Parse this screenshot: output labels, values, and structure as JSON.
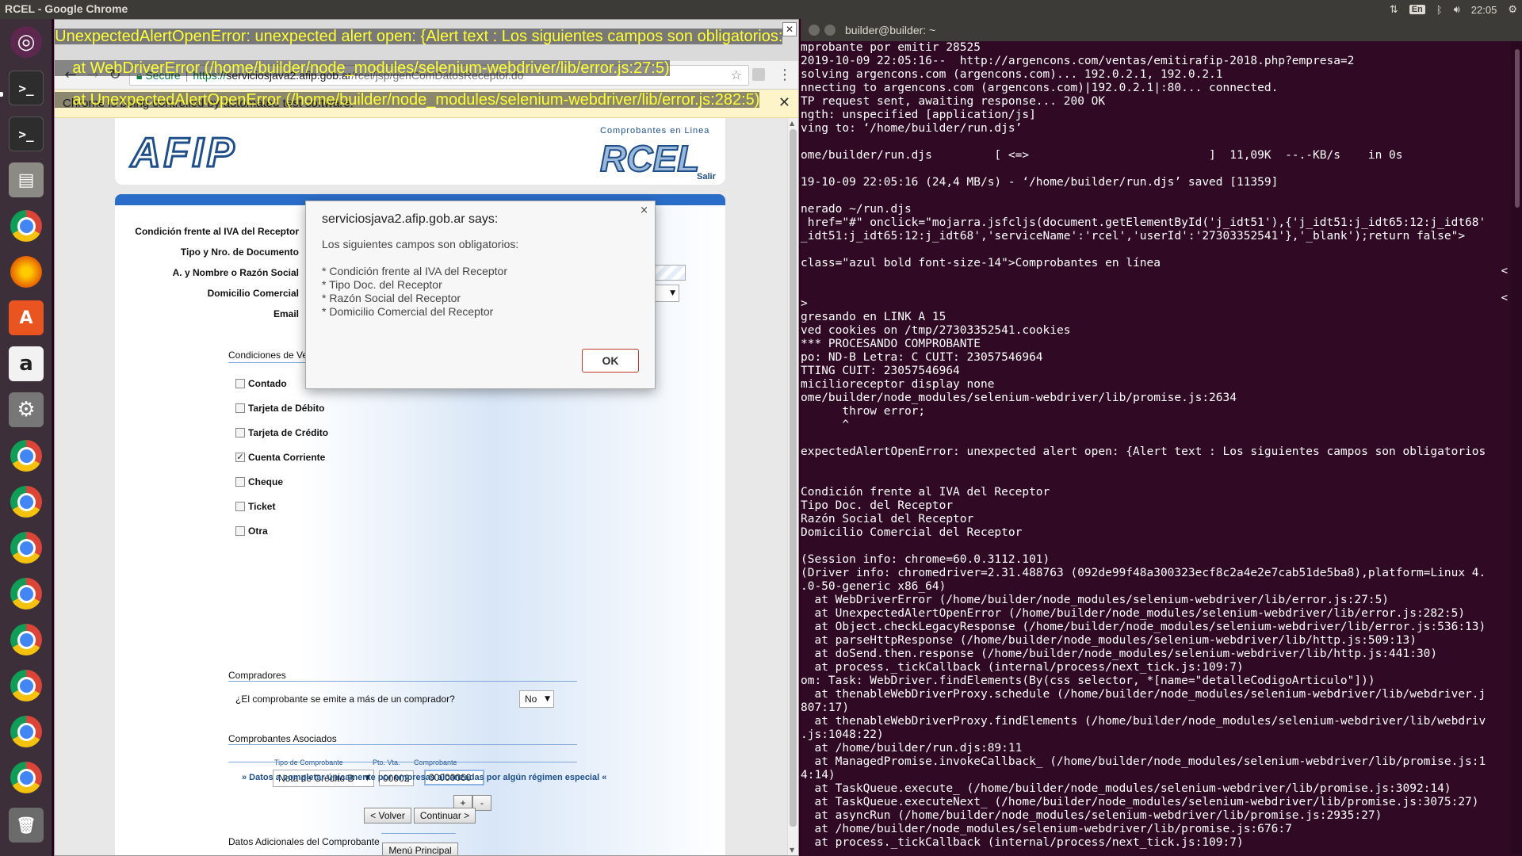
{
  "panel": {
    "app_title": "RCEL - Google Chrome",
    "keyboard_layout": "En",
    "clock": "22:05"
  },
  "error_overlay": {
    "lines": [
      "UnexpectedAlertOpenError: unexpected alert open: {Alert text : Los siguientes campos son obligatorios:",
      "    at WebDriverError (/home/builder/node_modules/selenium-webdriver/lib/error.js:27:5)",
      "    at UnexpectedAlertOpenError (/home/builder/node_modules/selenium-webdriver/lib/error.js:282:5)"
    ]
  },
  "chrome": {
    "close_glyph": "✕",
    "omnibox": {
      "secure_label": "Secure",
      "scheme": "https://",
      "host": "serviciosjava2.afip.gob.ar",
      "path": "/rcel/jsp/genComDatosReceptor.do"
    },
    "infobar": {
      "text": "Chrome is being controlled by automated test software."
    }
  },
  "afip": {
    "logo_text": "AFIP",
    "rcel_subtitle": "Comprobantes en Linea",
    "rcel_logo": "RCEL",
    "salir_label": "Salir",
    "fields": {
      "condicion_iva_label": "Condición frente al IVA del Receptor",
      "tipo_doc_label": "Tipo y Nro. de Documento",
      "razon_social_label": "A. y Nombre o Razón Social",
      "domicilio_label": "Domicilio Comercial",
      "email_label": "Email"
    },
    "condiciones_venta": {
      "title": "Condiciones de Venta",
      "options": [
        {
          "label": "Contado",
          "checked": false
        },
        {
          "label": "Tarjeta de Débito",
          "checked": false
        },
        {
          "label": "Tarjeta de Crédito",
          "checked": false
        },
        {
          "label": "Cuenta Corriente",
          "checked": true
        },
        {
          "label": "Cheque",
          "checked": false
        },
        {
          "label": "Ticket",
          "checked": false
        },
        {
          "label": "Otra",
          "checked": false
        }
      ]
    },
    "compradores": {
      "title": "Compradores",
      "question": "¿El comprobante se emite a más de un comprador?",
      "answer": "No"
    },
    "asociados": {
      "title": "Comprobantes Asociados",
      "col_tipo": "Tipo de Comprobante",
      "col_pto": "Pto. Vta.",
      "col_comprobante": "Comprobante",
      "tipo_value": "Nota de Crédito B",
      "pto_value": "00002",
      "dash": "-",
      "comprobante_value": "00000060",
      "add_label": "+",
      "remove_label": "-"
    },
    "datos_adicionales": {
      "title": "Datos Adicionales del Comprobante",
      "link": "» Datos a completar únicamente por empresas alcanzadas por algún régimen especial «"
    },
    "buttons": {
      "volver": "< Volver",
      "continuar": "Continuar >",
      "menu_principal": "Menú Principal"
    }
  },
  "alert": {
    "title": "serviciosjava2.afip.gob.ar says:",
    "close_glyph": "×",
    "message": "Los siguientes campos son obligatorios:",
    "fields": [
      "* Condición frente al IVA del Receptor",
      "* Tipo Doc. del Receptor",
      "* Razón Social del Receptor",
      "* Domicilio Comercial del Receptor"
    ],
    "ok_label": "OK"
  },
  "terminal": {
    "title": "builder@builder: ~",
    "lines": [
      "mprobante por emitir 28525",
      "2019-10-09 22:05:16--  http://argencons.com/ventas/emitirafip-2018.php?empresa=2",
      "solving argencons.com (argencons.com)... 192.0.2.1, 192.0.2.1",
      "nnecting to argencons.com (argencons.com)|192.0.2.1|:80... connected.",
      "TP request sent, awaiting response... 200 OK",
      "ngth: unspecified [application/js]",
      "ving to: ‘/home/builder/run.djs’",
      "",
      "ome/builder/run.djs         [ <=>                          ]  11,09K  --.-KB/s    in 0s",
      "",
      "19-10-09 22:05:16 (24,4 MB/s) - ‘/home/builder/run.djs’ saved [11359]",
      "",
      "nerado ~/run.djs",
      " href=\"#\" onclick=\"mojarra.jsfcljs(document.getElementById('j_idt51'),{'j_idt51:j_idt65:12:j_idt68'",
      "_idt51:j_idt65:12:j_idt68','serviceName':'rcel','userId':'27303352541'},'_blank');return false\">",
      "",
      "class=\"azul bold font-size-14\">Comprobantes en línea",
      "",
      "",
      ">",
      "gresando en LINK A 15",
      "ved cookies on /tmp/27303352541.cookies",
      "*** PROCESANDO COMPROBANTE",
      "po: ND-B Letra: C CUIT: 23057546964",
      "TTING CUIT: 23057546964",
      "micilioreceptor display none",
      "ome/builder/node_modules/selenium-webdriver/lib/promise.js:2634",
      "      throw error;",
      "      ^",
      "",
      "expectedAlertOpenError: unexpected alert open: {Alert text : Los siguientes campos son obligatorios",
      "",
      "",
      "Condición frente al IVA del Receptor",
      "Tipo Doc. del Receptor",
      "Razón Social del Receptor",
      "Domicilio Comercial del Receptor",
      "",
      "(Session info: chrome=60.0.3112.101)",
      "(Driver info: chromedriver=2.31.488763 (092de99f48a300323ecf8c2a4e2e7cab51de5ba8),platform=Linux 4.",
      ".0-50-generic x86_64)",
      "  at WebDriverError (/home/builder/node_modules/selenium-webdriver/lib/error.js:27:5)",
      "  at UnexpectedAlertOpenError (/home/builder/node_modules/selenium-webdriver/lib/error.js:282:5)",
      "  at Object.checkLegacyResponse (/home/builder/node_modules/selenium-webdriver/lib/error.js:536:13)",
      "  at parseHttpResponse (/home/builder/node_modules/selenium-webdriver/lib/http.js:509:13)",
      "  at doSend.then.response (/home/builder/node_modules/selenium-webdriver/lib/http.js:441:30)",
      "  at process._tickCallback (internal/process/next_tick.js:109:7)",
      "om: Task: WebDriver.findElements(By(css selector, *[name=\"detalleCodigoArticulo\"]))",
      "  at thenableWebDriverProxy.schedule (/home/builder/node_modules/selenium-webdriver/lib/webdriver.j",
      "807:17)",
      "  at thenableWebDriverProxy.findElements (/home/builder/node_modules/selenium-webdriver/lib/webdriv",
      ".js:1048:22)",
      "  at /home/builder/run.djs:89:11",
      "  at ManagedPromise.invokeCallback_ (/home/builder/node_modules/selenium-webdriver/lib/promise.js:1",
      "4:14)",
      "  at TaskQueue.execute_ (/home/builder/node_modules/selenium-webdriver/lib/promise.js:3092:14)",
      "  at TaskQueue.executeNext_ (/home/builder/node_modules/selenium-webdriver/lib/promise.js:3075:27)",
      "  at asyncRun (/home/builder/node_modules/selenium-webdriver/lib/promise.js:2935:27)",
      "  at /home/builder/node_modules/selenium-webdriver/lib/promise.js:676:7",
      "  at process._tickCallback (internal/process/next_tick.js:109:7)"
    ]
  },
  "launcher": {
    "icons": [
      "ubuntu-dash-icon",
      "terminal-icon",
      "terminal-icon",
      "files-icon",
      "chrome-icon",
      "firefox-icon",
      "software-center-icon",
      "amazon-icon",
      "settings-icon",
      "chrome-icon",
      "chrome-icon",
      "chrome-icon",
      "chrome-icon",
      "chrome-icon",
      "chrome-icon",
      "chrome-icon",
      "chrome-icon",
      "trash-icon"
    ]
  }
}
